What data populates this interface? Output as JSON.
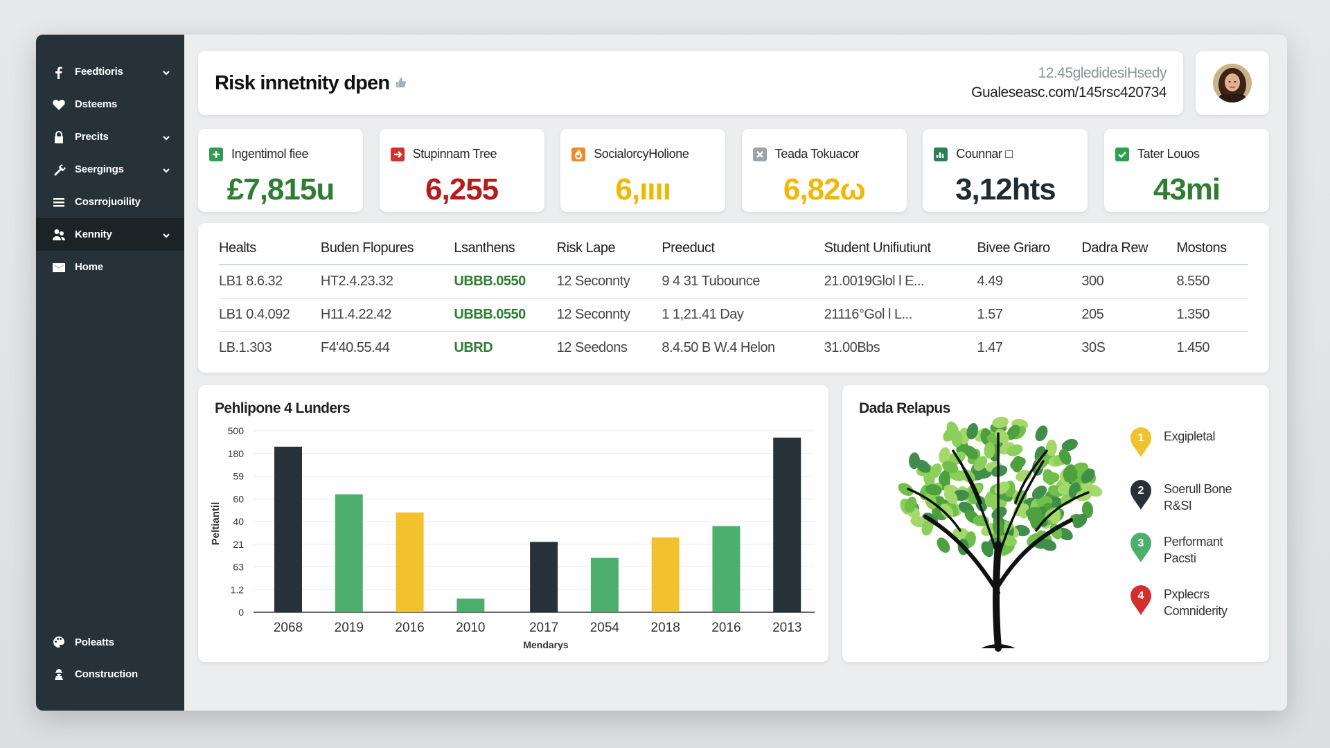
{
  "sidebar": {
    "items": [
      {
        "label": "Feedtioris",
        "icon": "facebook-icon",
        "chevron": true,
        "active": false
      },
      {
        "label": "Dsteems",
        "icon": "heart-icon",
        "chevron": false,
        "active": false
      },
      {
        "label": "Precits",
        "icon": "lock-icon",
        "chevron": true,
        "active": false
      },
      {
        "label": "Seergings",
        "icon": "tools-icon",
        "chevron": true,
        "active": false
      },
      {
        "label": "Cosrrojuoility",
        "icon": "menu-icon",
        "chevron": false,
        "active": false
      },
      {
        "label": "Kennity",
        "icon": "users-icon",
        "chevron": true,
        "active": true
      },
      {
        "label": "Home",
        "icon": "mail-icon",
        "chevron": false,
        "active": false
      }
    ],
    "bottom": [
      {
        "label": "Poleatts",
        "icon": "palette-icon"
      },
      {
        "label": "Construction",
        "icon": "worker-icon"
      }
    ]
  },
  "header": {
    "title": "Risk innetnity dpen",
    "meta_line1": "12.45gledidesiHsedy",
    "meta_line2": "Gualeseasc.com/145rsc420734"
  },
  "kpis": [
    {
      "label": "Ingentimol fiee",
      "value": "£7,815u",
      "color": "#2e7d32",
      "icon_color": "#2e9e4f",
      "icon": "plus-icon"
    },
    {
      "label": "Stupinnam Tree",
      "value": "6,255",
      "color": "#b71c1c",
      "icon_color": "#d32f2f",
      "icon": "arrow-icon"
    },
    {
      "label": "SocialorcyHolione",
      "value": "6,ıııı",
      "color": "#f2b705",
      "icon_color": "#f08a24",
      "icon": "flame-icon"
    },
    {
      "label": "Teada Tokuacor",
      "value": "6,82ω",
      "color": "#f2b705",
      "icon_color": "#9aa4aa",
      "icon": "close-icon"
    },
    {
      "label": "Counnar □",
      "value": "3,12hts",
      "color": "#1f2d33",
      "icon_color": "#2e7d55",
      "icon": "chart-icon"
    },
    {
      "label": "Tater Louos",
      "value": "43mi",
      "color": "#2e7d32",
      "icon_color": "#2e9e4f",
      "icon": "check-icon"
    }
  ],
  "table": {
    "columns": [
      "Healts",
      "Buden Flopures",
      "Lsanthens",
      "Risk Lape",
      "Preeduct",
      "Student Unifiutiunt",
      "Bivee Griaro",
      "Dadra Rew",
      "Mostons"
    ],
    "rows": [
      [
        "LB1 8.6.32",
        "HT2.4.23.32",
        "UBBB.0550",
        "12 Seconnty",
        "9 4 31 Tubounce",
        "21.0019Glol l E...",
        "4.49",
        "300",
        "8.550"
      ],
      [
        "LB1 0.4.092",
        "H11.4.22.42",
        "UBBB.0550",
        "12 Seconnty",
        "1 1,21.41 Day",
        "21116°Gol l L...",
        "1.57",
        "205",
        "1.350"
      ],
      [
        "LB.1.303",
        "F4'40.55.44",
        "UBRD",
        "12 Seedons",
        "8.4.50 B W.4 Helon",
        "31.00Bbs",
        "1.47",
        "30S",
        "1.450"
      ]
    ]
  },
  "chart_data": {
    "type": "bar",
    "title": "Pehlipone 4 Lunders",
    "xlabel": "Mendarys",
    "ylabel": "Peltiantil",
    "y_tick_labels": [
      "500",
      "180",
      "59",
      "60",
      "40",
      "21",
      "63",
      "1.2",
      "0"
    ],
    "categories": [
      "2068",
      "2019",
      "2016",
      "2010",
      "2017",
      "2054",
      "2018",
      "2016",
      "2013"
    ],
    "values": [
      7.3,
      5.2,
      4.4,
      0.6,
      3.1,
      2.4,
      3.3,
      3.8,
      7.7
    ],
    "bar_colors": [
      "#263238",
      "#4caf6e",
      "#f2c12e",
      "#4caf6e",
      "#263238",
      "#4caf6e",
      "#f2c12e",
      "#4caf6e",
      "#263238"
    ],
    "ylim": [
      0,
      8
    ],
    "grid": true
  },
  "tree_card": {
    "title": "Dada Relapus",
    "legend": [
      {
        "num": "1",
        "label": "Exgipletal",
        "color": "#f2c12e"
      },
      {
        "num": "2",
        "label": "Soerull Bone R&SI",
        "color": "#263238"
      },
      {
        "num": "3",
        "label": "Performant Pacsti",
        "color": "#4caf6e"
      },
      {
        "num": "4",
        "label": "Pxplecrs Comniderity",
        "color": "#d32f2f"
      }
    ]
  }
}
